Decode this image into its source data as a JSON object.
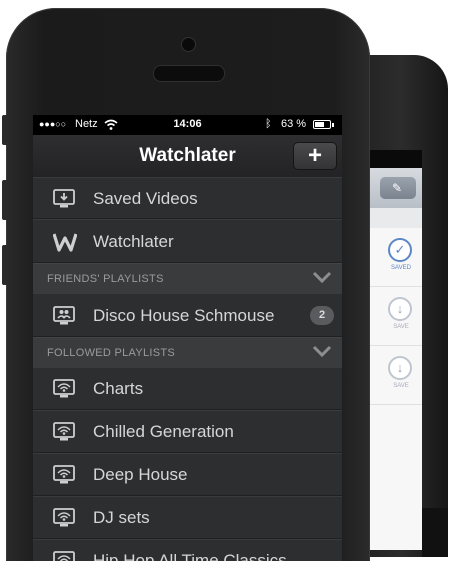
{
  "status_bar": {
    "signal": "●●●○○",
    "carrier": "Netz",
    "time": "14:06",
    "battery_pct": "63 %",
    "battery_level": 0.63
  },
  "nav": {
    "title": "Watchlater",
    "add_label": "+"
  },
  "menu": {
    "items": [
      {
        "label": "Saved Videos",
        "icon": "monitor-download-icon"
      },
      {
        "label": "Watchlater",
        "icon": "watchlater-logo-icon"
      }
    ]
  },
  "friends_section": {
    "title": "FRIENDS' PLAYLISTS",
    "items": [
      {
        "label": "Disco House Schmouse",
        "badge": "2",
        "icon": "monitor-users-icon"
      }
    ]
  },
  "followed_section": {
    "title": "FOLLOWED PLAYLISTS",
    "items": [
      {
        "label": "Charts",
        "icon": "monitor-broadcast-icon"
      },
      {
        "label": "Chilled Generation",
        "icon": "monitor-broadcast-icon"
      },
      {
        "label": "Deep House",
        "icon": "monitor-broadcast-icon"
      },
      {
        "label": "DJ sets",
        "icon": "monitor-broadcast-icon"
      },
      {
        "label": "Hip Hop All Time Classics",
        "icon": "monitor-broadcast-icon"
      }
    ]
  },
  "back_screen": {
    "saved_label": "SAVED",
    "save_label": "SAVE"
  }
}
